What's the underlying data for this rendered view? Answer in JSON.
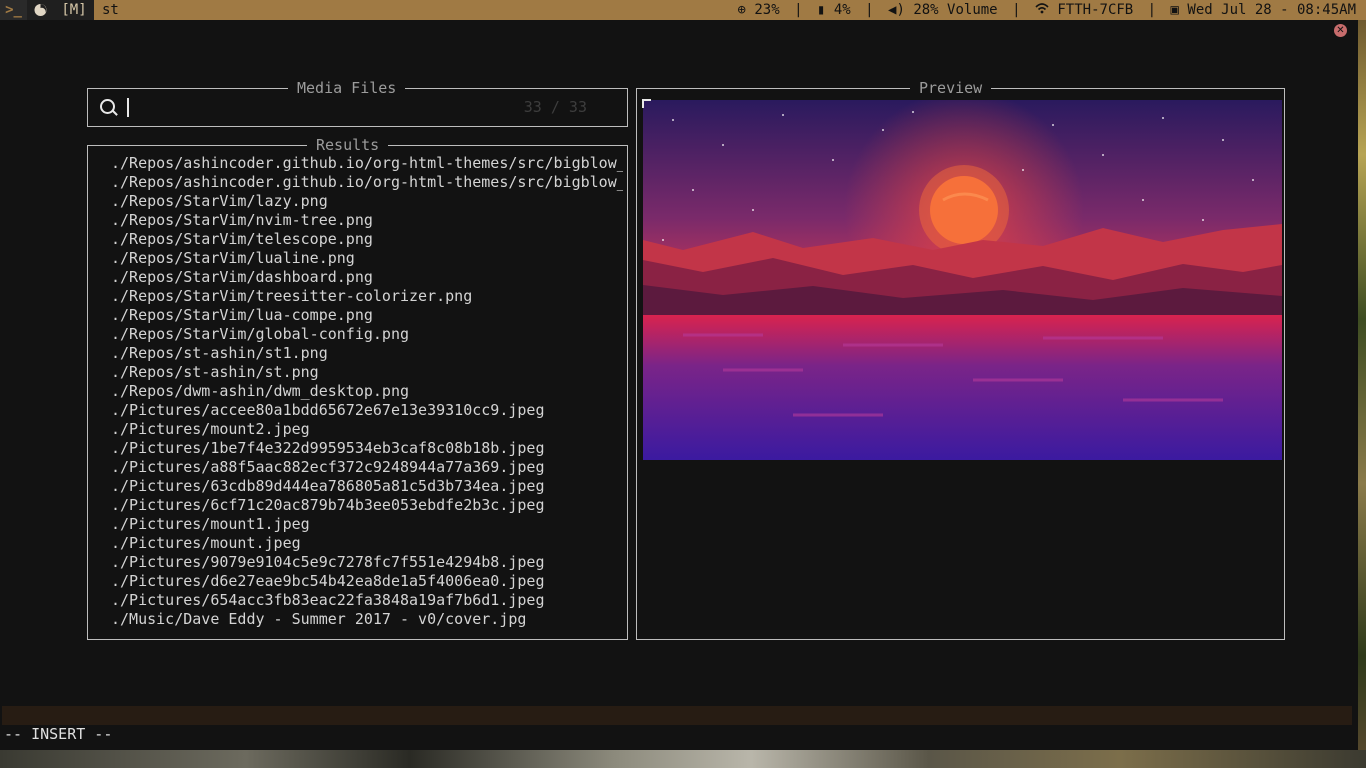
{
  "topbar": {
    "terminal_glyph": ">_",
    "layout": "[M]",
    "window_title": "st",
    "status": {
      "cpu": "23%",
      "mem": "4%",
      "volume": "28% Volume",
      "wifi": "FTTH-7CFB",
      "datetime": "Wed Jul 28 - 08:45AM"
    }
  },
  "telescope": {
    "prompt_title": "Media Files",
    "prompt_value": "",
    "counter": "33 / 33",
    "results_title": "Results",
    "preview_title": "Preview",
    "results": [
      "./Repos/ashincoder.github.io/org-html-themes/src/bigblow_",
      "./Repos/ashincoder.github.io/org-html-themes/src/bigblow_",
      "./Repos/StarVim/lazy.png",
      "./Repos/StarVim/nvim-tree.png",
      "./Repos/StarVim/telescope.png",
      "./Repos/StarVim/lualine.png",
      "./Repos/StarVim/dashboard.png",
      "./Repos/StarVim/treesitter-colorizer.png",
      "./Repos/StarVim/lua-compe.png",
      "./Repos/StarVim/global-config.png",
      "./Repos/st-ashin/st1.png",
      "./Repos/st-ashin/st.png",
      "./Repos/dwm-ashin/dwm_desktop.png",
      "./Pictures/accee80a1bdd65672e67e13e39310cc9.jpeg",
      "./Pictures/mount2.jpeg",
      "./Pictures/1be7f4e322d9959534eb3caf8c08b18b.jpeg",
      "./Pictures/a88f5aac882ecf372c9248944a77a369.jpeg",
      "./Pictures/63cdb89d444ea786805a81c5d3b734ea.jpeg",
      "./Pictures/6cf71c20ac879b74b3ee053ebdfe2b3c.jpeg",
      "./Pictures/mount1.jpeg",
      "./Pictures/mount.jpeg",
      "./Pictures/9079e9104c5e9c7278fc7f551e4294b8.jpeg",
      "./Pictures/d6e27eae9bc54b42ea8de1a5f4006ea0.jpeg",
      "./Pictures/654acc3fb83eac22fa3848a19af7b6d1.jpeg",
      "./Music/Dave Eddy - Summer 2017 - v0/cover.jpg"
    ]
  },
  "statusline": {
    "mode": "-- INSERT --"
  },
  "icons": {
    "topbar": [
      "terminal-icon",
      "browser-icon",
      "cpu-icon",
      "memory-icon",
      "volume-icon",
      "wifi-icon",
      "calendar-icon"
    ],
    "window": [
      "close-icon"
    ],
    "prompt": [
      "search-icon"
    ]
  },
  "colors": {
    "topbar_bg": "#a07a44",
    "panel_border": "#bdbdbd",
    "title_fg": "#9c9c9c",
    "sky_top": "#2a1a5e",
    "sun": "#f45a2a",
    "mountain": "#c23548",
    "water": "#3a1a9a"
  }
}
